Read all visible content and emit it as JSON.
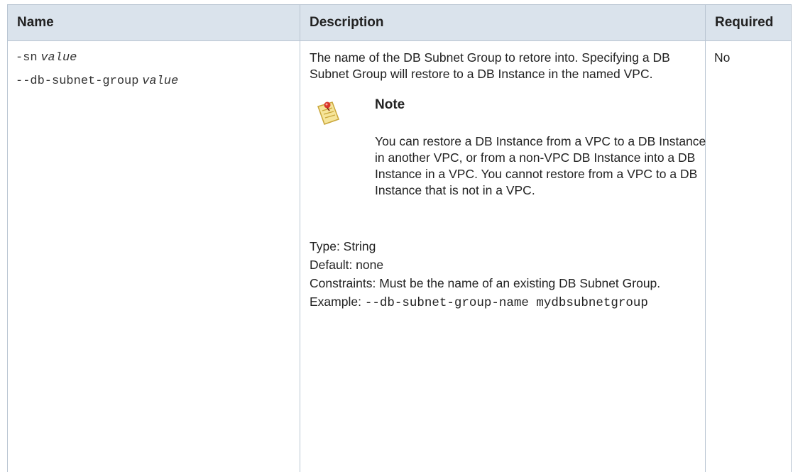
{
  "headers": {
    "name": "Name",
    "description": "Description",
    "required": "Required"
  },
  "row": {
    "names": [
      {
        "flag": "-sn",
        "arg": "value"
      },
      {
        "flag": "--db-subnet-group",
        "arg": "value"
      }
    ],
    "description": "The name of the DB Subnet Group to retore into. Specifying a DB Subnet Group will restore to a DB Instance in the named VPC.",
    "note": {
      "icon": "note-pad-icon",
      "title": "Note",
      "body": "You can restore a DB Instance from a VPC to a DB Instance in another VPC, or from a non-VPC DB Instance into a DB Instance in a VPC. You cannot restore from a VPC to a DB Instance that is not in a VPC."
    },
    "type": "Type: String",
    "default": "Default: none",
    "constraints": "Constraints: Must be the name of an existing DB Subnet Group.",
    "example_label": "Example:",
    "example_code": "--db-subnet-group-name mydbsubnetgroup",
    "required": "No"
  }
}
